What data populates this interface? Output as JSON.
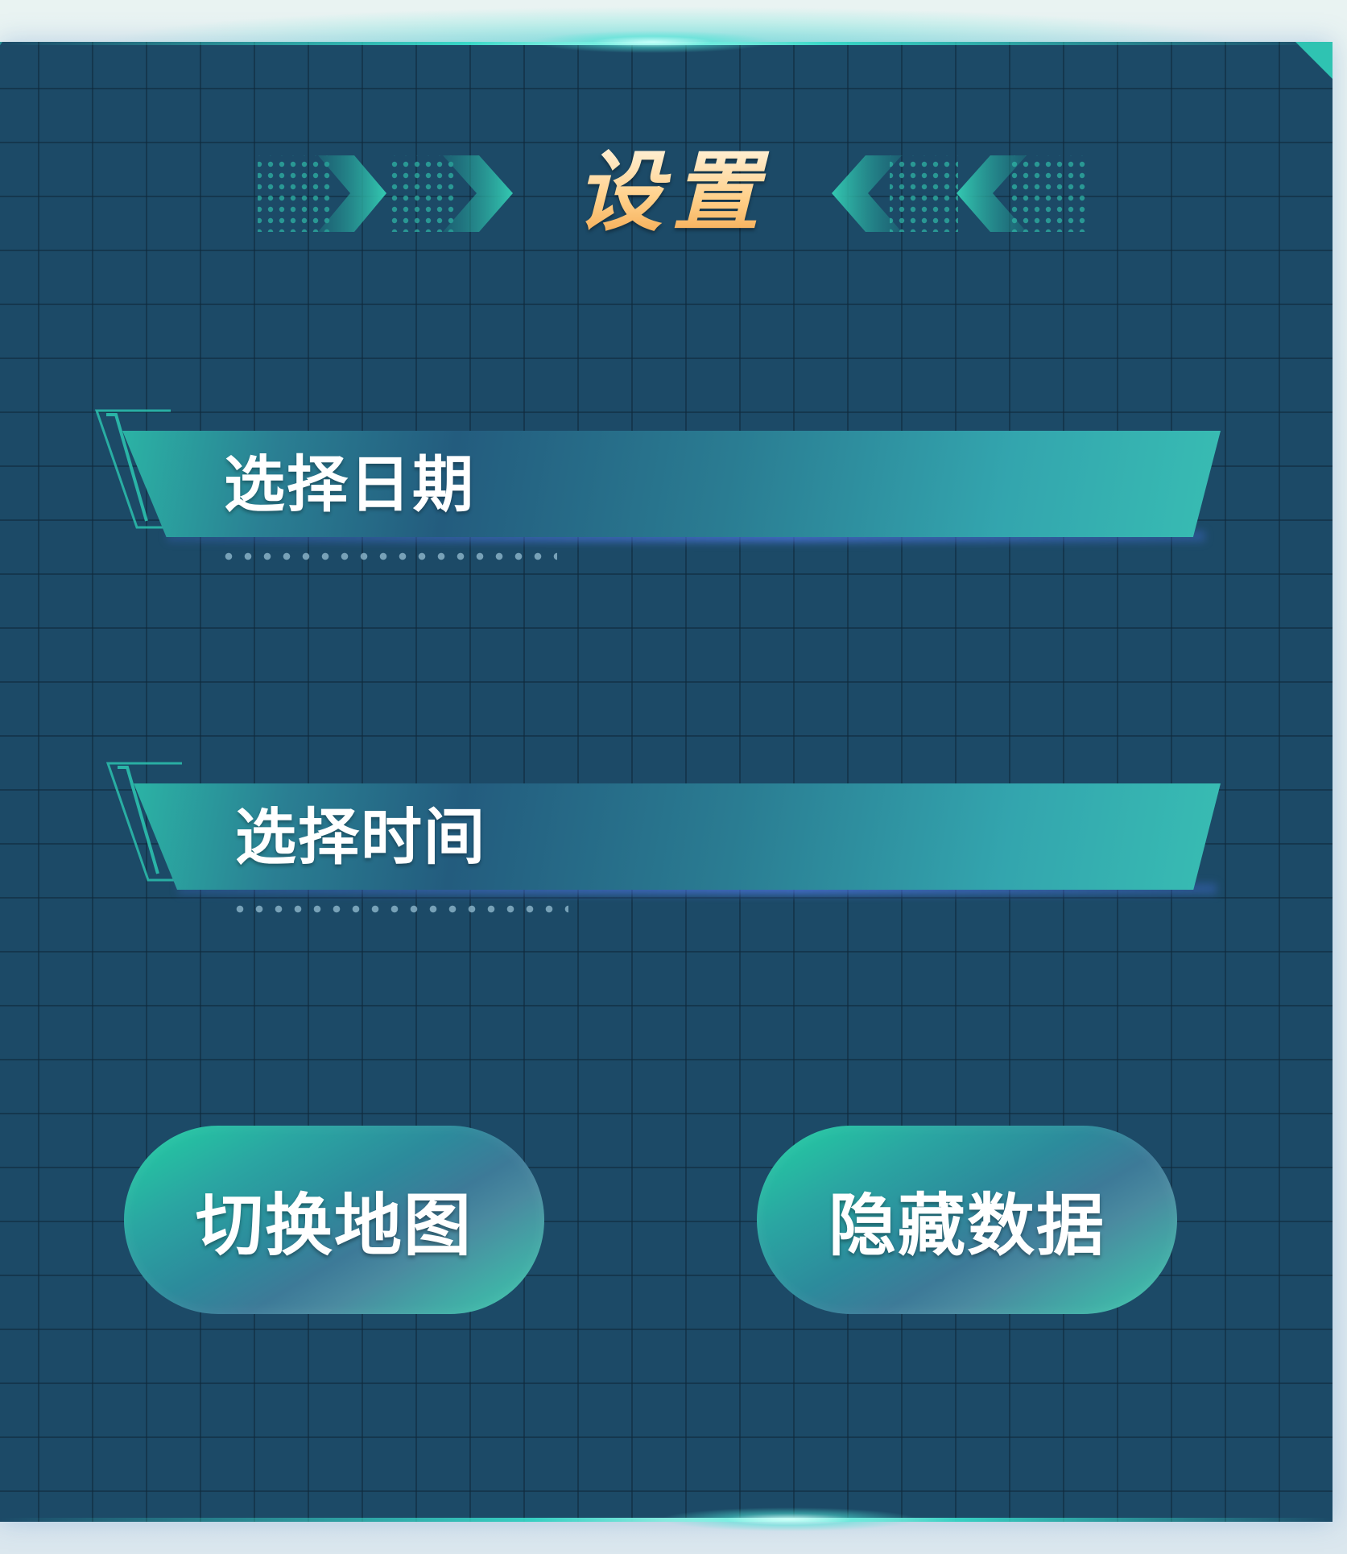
{
  "dialog": {
    "title": "设置"
  },
  "sections": [
    {
      "label": "选择日期"
    },
    {
      "label": "选择时间"
    }
  ],
  "buttons": {
    "switch_map": "切换地图",
    "hide_data": "隐藏数据"
  },
  "colors": {
    "panel_background": "#1c4a67",
    "accent_teal": "#2fc3b2",
    "title_gold": "#ffd08a",
    "button_green": "#22d2a3"
  }
}
